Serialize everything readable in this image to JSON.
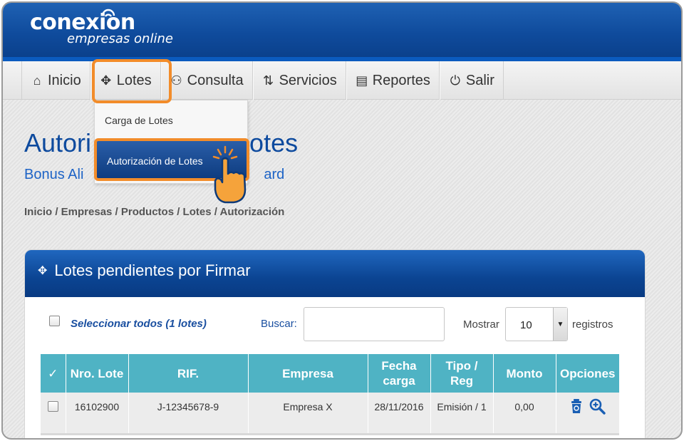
{
  "brand": {
    "name": "conexion",
    "tagline": "empresas online"
  },
  "nav": {
    "items": [
      {
        "label": "Inicio",
        "icon": "home-icon"
      },
      {
        "label": "Lotes",
        "icon": "lotes-icon"
      },
      {
        "label": "Consulta",
        "icon": "consulta-icon"
      },
      {
        "label": "Servicios",
        "icon": "servicios-icon"
      },
      {
        "label": "Reportes",
        "icon": "reportes-icon"
      },
      {
        "label": "Salir",
        "icon": "power-icon"
      }
    ]
  },
  "dropdown": {
    "items": [
      "Carga de Lotes",
      "Autorización de Lotes"
    ]
  },
  "page": {
    "title_left": "Autori",
    "title_right": "otes",
    "subtitle_left": "Bonus Ali",
    "subtitle_right": "ard",
    "breadcrumb": "Inicio / Empresas / Productos / Lotes / Autorización"
  },
  "panel": {
    "title": "Lotes pendientes por Firmar",
    "select_all": "Seleccionar todos (1 lotes)",
    "search_label": "Buscar:",
    "search_value": "",
    "show_label": "Mostrar",
    "show_value": "10",
    "records_label": "registros"
  },
  "table": {
    "headers": [
      "✓",
      "Nro. Lote",
      "RIF.",
      "Empresa",
      "Fecha carga",
      "Tipo / Reg",
      "Monto",
      "Opciones"
    ],
    "rows": [
      {
        "lote": "16102900",
        "rif": "J-12345678-9",
        "empresa": "Empresa X",
        "fecha": "28/11/2016",
        "tipo": "Emisión / 1",
        "monto": "0,00"
      }
    ]
  },
  "colors": {
    "header_blue": "#0f4b9c",
    "accent_orange": "#f28c2a",
    "table_header": "#4fb3c4"
  }
}
